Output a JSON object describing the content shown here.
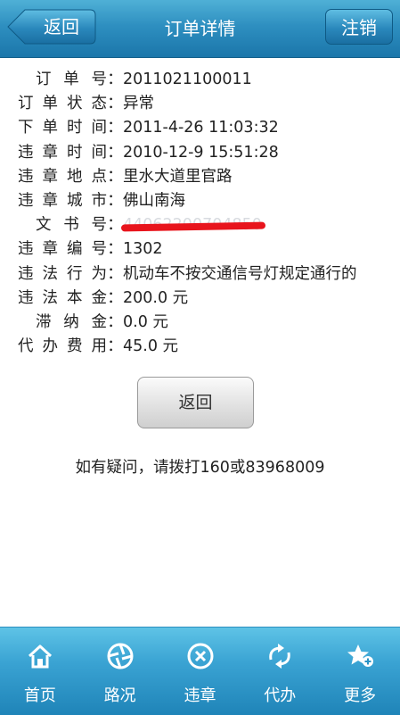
{
  "header": {
    "title": "订单详情",
    "back_label": "返回",
    "logout_label": "注销"
  },
  "details": [
    {
      "label": "订单号",
      "value": "2011021100011"
    },
    {
      "label": "订单状态",
      "value": "异常"
    },
    {
      "label": "下单时间",
      "value": "2011-4-26 11:03:32"
    },
    {
      "label": "违章时间",
      "value": "2010-12-9 15:51:28"
    },
    {
      "label": "违章地点",
      "value": "里水大道里官路"
    },
    {
      "label": "违章城市",
      "value": "佛山南海"
    },
    {
      "label": "文书号",
      "value": "44062200704850"
    },
    {
      "label": "违章编号",
      "value": "1302"
    },
    {
      "label": "违法行为",
      "value": "机动车不按交通信号灯规定通行的"
    },
    {
      "label": "违法本金",
      "value": "200.0 元"
    },
    {
      "label": "滞纳金",
      "value": "0.0 元"
    },
    {
      "label": "代办费用",
      "value": "45.0 元"
    }
  ],
  "separator": "：",
  "actions": {
    "return_label": "返回"
  },
  "hint": "如有疑问，请拨打160或83968009",
  "tabbar": {
    "items": [
      {
        "label": "首页",
        "icon": "home-icon"
      },
      {
        "label": "路况",
        "icon": "aperture-icon"
      },
      {
        "label": "违章",
        "icon": "close-circle-icon"
      },
      {
        "label": "代办",
        "icon": "refresh-arrows-icon"
      },
      {
        "label": "更多",
        "icon": "star-plus-icon"
      }
    ]
  },
  "colors": {
    "header": "#2e8fc0",
    "tabbar": "#3aa3d3",
    "redaction": "#e8141c"
  }
}
